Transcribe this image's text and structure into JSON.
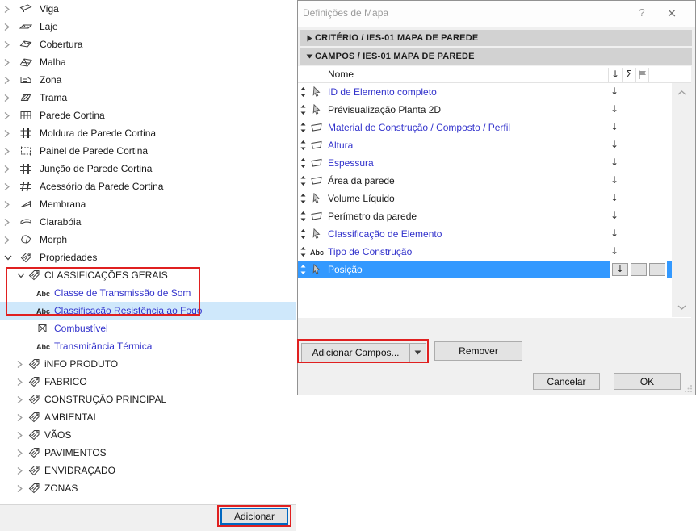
{
  "left_panel": {
    "tree": [
      {
        "label": "Viga",
        "icon": "beam",
        "level": 0,
        "expander": "collapsed"
      },
      {
        "label": "Laje",
        "icon": "slab",
        "level": 0,
        "expander": "collapsed"
      },
      {
        "label": "Cobertura",
        "icon": "roof",
        "level": 0,
        "expander": "collapsed"
      },
      {
        "label": "Malha",
        "icon": "mesh",
        "level": 0,
        "expander": "collapsed"
      },
      {
        "label": "Zona",
        "icon": "zone",
        "level": 0,
        "expander": "collapsed"
      },
      {
        "label": "Trama",
        "icon": "fill",
        "level": 0,
        "expander": "collapsed"
      },
      {
        "label": "Parede Cortina",
        "icon": "curtain-wall",
        "level": 0,
        "expander": "collapsed"
      },
      {
        "label": "Moldura de Parede Cortina",
        "icon": "cw-frame",
        "level": 0,
        "expander": "collapsed"
      },
      {
        "label": "Painel de Parede Cortina",
        "icon": "cw-panel",
        "level": 0,
        "expander": "collapsed"
      },
      {
        "label": "Junção de Parede Cortina",
        "icon": "cw-junction",
        "level": 0,
        "expander": "collapsed"
      },
      {
        "label": "Acessório da Parede Cortina",
        "icon": "cw-accessory",
        "level": 0,
        "expander": "collapsed"
      },
      {
        "label": "Membrana",
        "icon": "membrane",
        "level": 0,
        "expander": "collapsed"
      },
      {
        "label": "Clarabóia",
        "icon": "skylight",
        "level": 0,
        "expander": "collapsed"
      },
      {
        "label": "Morph",
        "icon": "morph",
        "level": 0,
        "expander": "collapsed"
      },
      {
        "label": "Propriedades",
        "icon": "tag",
        "level": 0,
        "expander": "expanded"
      },
      {
        "label": "CLASSIFICAÇÕES GERAIS",
        "icon": "tag",
        "level": 1,
        "expander": "expanded"
      },
      {
        "label": "Classe de Transmissão de Som",
        "icon": "abc",
        "level": 2,
        "color": "blue"
      },
      {
        "label": "Classificação Resistência ao Fogo",
        "icon": "abc",
        "level": 2,
        "color": "blue",
        "selected": true
      },
      {
        "label": "Combustível",
        "icon": "checkbox",
        "level": 2,
        "color": "blue"
      },
      {
        "label": "Transmitância Térmica",
        "icon": "abc",
        "level": 2,
        "color": "blue"
      },
      {
        "label": "iNFO PRODUTO",
        "icon": "tag",
        "level": 1,
        "expander": "collapsed"
      },
      {
        "label": "FABRICO",
        "icon": "tag",
        "level": 1,
        "expander": "collapsed"
      },
      {
        "label": "CONSTRUÇÃO PRINCIPAL",
        "icon": "tag",
        "level": 1,
        "expander": "collapsed"
      },
      {
        "label": "AMBIENTAL",
        "icon": "tag",
        "level": 1,
        "expander": "collapsed"
      },
      {
        "label": "VÃOS",
        "icon": "tag",
        "level": 1,
        "expander": "collapsed"
      },
      {
        "label": "PAVIMENTOS",
        "icon": "tag",
        "level": 1,
        "expander": "collapsed"
      },
      {
        "label": "ENVIDRAÇADO",
        "icon": "tag",
        "level": 1,
        "expander": "collapsed"
      },
      {
        "label": "ZONAS",
        "icon": "tag",
        "level": 1,
        "expander": "collapsed"
      }
    ],
    "add_button_label": "Adicionar"
  },
  "dialog": {
    "title": "Definições de Mapa",
    "help_glyph": "?",
    "close_glyph": "×",
    "sections": [
      {
        "label": "CRITÉRIO / IES-01 MAPA DE PAREDE",
        "state": "collapsed"
      },
      {
        "label": "CAMPOS / IES-01 MAPA DE PAREDE",
        "state": "expanded"
      }
    ],
    "table": {
      "name_column_header": "Nome",
      "header_icons": [
        {
          "name": "sort-descending-icon",
          "glyph": "↓"
        },
        {
          "name": "sum-icon",
          "glyph": "Σ"
        },
        {
          "name": "flag-icon",
          "glyph": "flag"
        }
      ],
      "row_sort_glyph": "↓",
      "rows": [
        {
          "name": "ID de Elemento completo",
          "icon": "cursor",
          "color": "blue"
        },
        {
          "name": "Prévisualização Planta 2D",
          "icon": "cursor",
          "color": "black"
        },
        {
          "name": "Material de Construção / Composto / Perfil",
          "icon": "polygon",
          "color": "blue"
        },
        {
          "name": "Altura",
          "icon": "polygon",
          "color": "blue"
        },
        {
          "name": "Espessura",
          "icon": "polygon",
          "color": "blue"
        },
        {
          "name": "Área da parede",
          "icon": "polygon",
          "color": "black"
        },
        {
          "name": "Volume Líquido",
          "icon": "cursor",
          "color": "black"
        },
        {
          "name": "Perímetro da parede",
          "icon": "polygon",
          "color": "black"
        },
        {
          "name": "Classificação de Elemento",
          "icon": "cursor",
          "color": "blue"
        },
        {
          "name": "Tipo de Construção",
          "icon": "abc",
          "color": "blue"
        },
        {
          "name": "Posição",
          "icon": "cursor",
          "color": "white",
          "selected": true
        }
      ],
      "selected_row_controls": {
        "sort_glyph": "↓",
        "empty_boxes": 2
      }
    },
    "buttons": {
      "add_fields": "Adicionar Campos...",
      "add_fields_dropdown_glyph": "▼",
      "remove": "Remover",
      "cancel": "Cancelar",
      "ok": "OK"
    }
  },
  "annotations": {
    "color": "#e02020",
    "boxes": [
      "classificacoes-gerais-group",
      "adicionar-campos-button",
      "adicionar-button"
    ]
  },
  "colors": {
    "selection_blue": "#3399ff",
    "tree_selection_blue": "#cfe8fb",
    "link_blue": "#3333cc",
    "section_bar_gray": "#d2d2d2",
    "dialog_gray": "#f0f0f0",
    "annotation_red": "#e02020",
    "focus_button_border": "#0067c0"
  }
}
